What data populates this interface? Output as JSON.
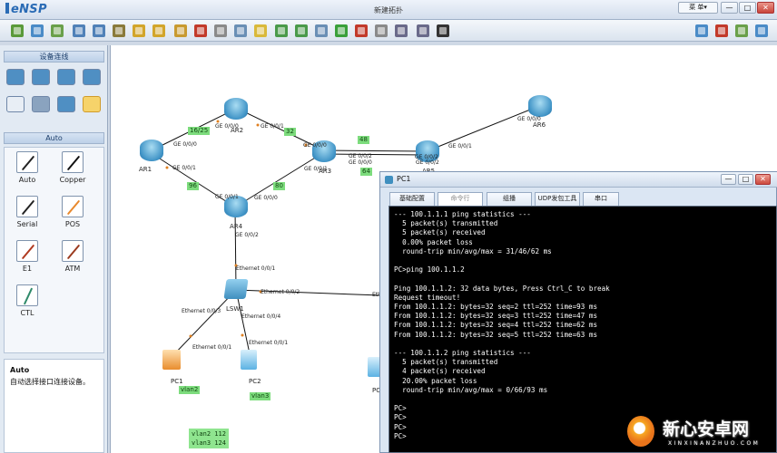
{
  "app": {
    "logo": "eNSP",
    "window_title": "新建拓扑",
    "menu_label": "菜 单▾",
    "min_btn": "—",
    "max_btn": "□",
    "close_btn": "✕"
  },
  "toolbar": {
    "icons": [
      "new-topo-icon",
      "new-example-icon",
      "open-icon",
      "save-icon",
      "save-as-icon",
      "print-icon",
      "undo-icon",
      "redo-icon",
      "drag-hand-icon",
      "delete-icon",
      "delete-all-connections-icon",
      "text-note-icon",
      "shape-icon",
      "zoom-in-icon",
      "zoom-out-icon",
      "fit-icon",
      "start-device-icon",
      "stop-device-icon",
      "capture-icon",
      "topo-grid-icon",
      "console-icon",
      "show-interfaces-icon",
      "message-icon",
      "huawei-icon",
      "settings-icon",
      "help-icon"
    ]
  },
  "left_panel": {
    "devices_header": "设备连线",
    "device_icons": [
      "router-category-icon",
      "switch-category-icon",
      "wlan-category-icon",
      "firewall-category-icon",
      "pc-category-icon",
      "cloud-category-icon",
      "other-device-icon",
      "connection-category-icon"
    ],
    "category_header": "Auto",
    "connections": [
      {
        "label": "Auto",
        "color": "#222222"
      },
      {
        "label": "Copper",
        "color": "#111111"
      },
      {
        "label": "Serial",
        "color": "#222222"
      },
      {
        "label": "POS",
        "color": "#e8882c"
      },
      {
        "label": "E1",
        "color": "#b03a20"
      },
      {
        "label": "ATM",
        "color": "#9b3b1f"
      },
      {
        "label": "CTL",
        "color": "#2f8a6a"
      }
    ],
    "desc_title": "Auto",
    "desc_text": "自动选择接口连接设备。"
  },
  "topology": {
    "devices": [
      {
        "name": "AR1",
        "type": "router"
      },
      {
        "name": "AR2",
        "type": "router"
      },
      {
        "name": "AR3",
        "type": "router"
      },
      {
        "name": "AR4",
        "type": "router"
      },
      {
        "name": "AR5",
        "type": "router"
      },
      {
        "name": "AR6",
        "type": "router"
      },
      {
        "name": "LSW1",
        "type": "switch"
      },
      {
        "name": "PC1",
        "type": "pc"
      },
      {
        "name": "PC2",
        "type": "pc"
      },
      {
        "name": "PC",
        "type": "pc"
      }
    ],
    "port_labels": [
      "GE 0/0/0",
      "GE 0/0/1",
      "GE 0/0/0",
      "GE 0/0/1",
      "GE 0/0/0",
      "GE 0/0/1",
      "GE 0/0/2",
      "GE 0/0/0",
      "GE 0/0/1",
      "GE 0/0/0",
      "GE 0/0/2",
      "GE 0/0/2",
      "GE 0/0/0",
      "GE 0/0/1",
      "GE 0/0/0",
      "GE 0/0/2",
      "Ethernet 0/0/1",
      "Ethernet 0/0/2",
      "Ethernet 0/0/3",
      "Ethernet 0/0/4",
      "Ethernet 0/0/1",
      "Ethernet 0/0/1",
      "Eth"
    ],
    "costs": [
      "16/25",
      "32",
      "96",
      "80",
      "48",
      "64"
    ],
    "vlan_tags": [
      "vlan2",
      "vlan3"
    ],
    "vlan_box": [
      "vlan2 112",
      "vlan3 124"
    ],
    "colors": {
      "link": "#111111",
      "cost_bg": "#7ddc7d"
    }
  },
  "pc_window": {
    "title": "PC1",
    "tabs": [
      "基础配置",
      "命令行",
      "组播",
      "UDP发包工具",
      "串口"
    ],
    "active_tab": "命令行",
    "console": [
      "--- 100.1.1.1 ping statistics ---",
      "  5 packet(s) transmitted",
      "  5 packet(s) received",
      "  0.00% packet loss",
      "  round-trip min/avg/max = 31/46/62 ms",
      "",
      "PC>ping 100.1.1.2",
      "",
      "Ping 100.1.1.2: 32 data bytes, Press Ctrl_C to break",
      "Request timeout!",
      "From 100.1.1.2: bytes=32 seq=2 ttl=252 time=93 ms",
      "From 100.1.1.2: bytes=32 seq=3 ttl=252 time=47 ms",
      "From 100.1.1.2: bytes=32 seq=4 ttl=252 time=62 ms",
      "From 100.1.1.2: bytes=32 seq=5 ttl=252 time=63 ms",
      "",
      "--- 100.1.1.2 ping statistics ---",
      "  5 packet(s) transmitted",
      "  4 packet(s) received",
      "  20.00% packet loss",
      "  round-trip min/avg/max = 0/66/93 ms",
      "",
      "PC>",
      "PC>",
      "PC>",
      "PC>"
    ]
  },
  "watermark": {
    "text": "新心安卓网",
    "sub": "XINXINANZHUO.COM"
  }
}
